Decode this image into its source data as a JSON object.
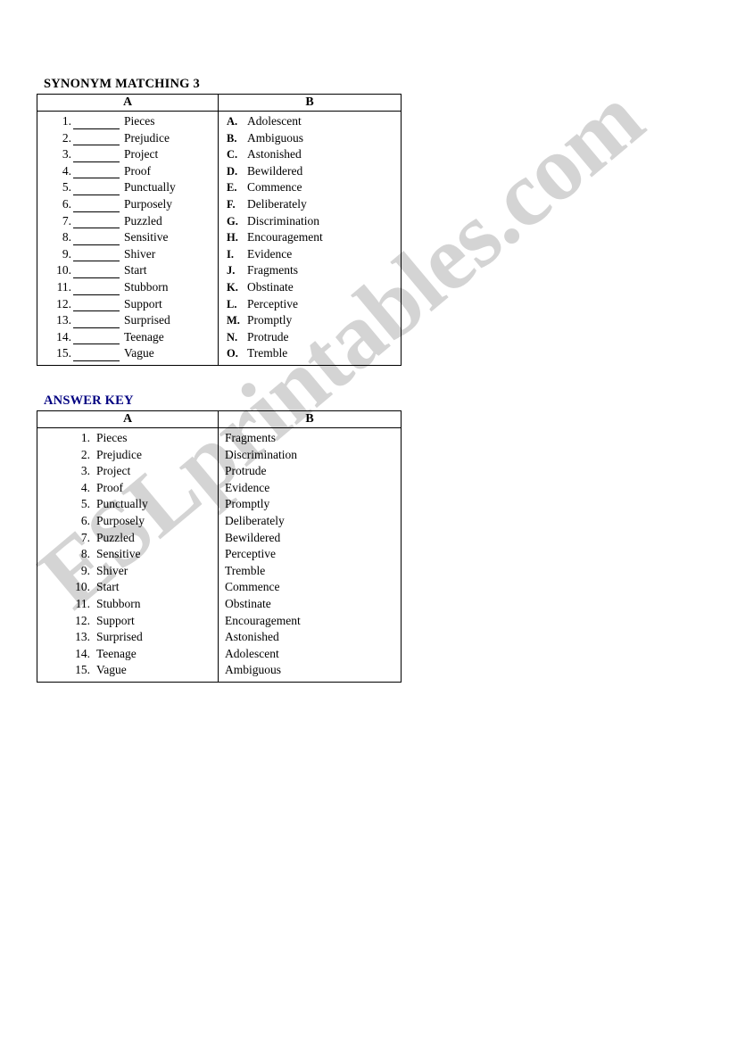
{
  "document": {
    "title": "SYNONYM MATCHING 3",
    "answer_key_title": "ANSWER KEY",
    "watermark": "ESLprintables.com",
    "colors": {
      "text": "#000000",
      "answer_key_heading": "#000080",
      "border": "#000000",
      "watermark": "#d4d4d4",
      "page_background": "#ffffff"
    }
  },
  "exercise": {
    "headers": {
      "a": "A",
      "b": "B"
    },
    "column_a": [
      {
        "num": "1.",
        "blank": "",
        "word": "Pieces"
      },
      {
        "num": "2.",
        "blank": "",
        "word": "Prejudice"
      },
      {
        "num": "3.",
        "blank": "",
        "word": "Project"
      },
      {
        "num": "4.",
        "blank": "",
        "word": "Proof"
      },
      {
        "num": "5.",
        "blank": "",
        "word": "Punctually"
      },
      {
        "num": "6.",
        "blank": "",
        "word": "Purposely"
      },
      {
        "num": "7.",
        "blank": "",
        "word": "Puzzled"
      },
      {
        "num": "8.",
        "blank": "",
        "word": "Sensitive"
      },
      {
        "num": "9.",
        "blank": "",
        "word": "Shiver"
      },
      {
        "num": "10.",
        "blank": "",
        "word": "Start"
      },
      {
        "num": "11.",
        "blank": "",
        "word": "Stubborn"
      },
      {
        "num": "12.",
        "blank": "",
        "word": "Support"
      },
      {
        "num": "13.",
        "blank": "",
        "word": "Surprised"
      },
      {
        "num": "14.",
        "blank": "",
        "word": "Teenage"
      },
      {
        "num": "15.",
        "blank": "",
        "word": "Vague"
      }
    ],
    "column_b": [
      {
        "letter": "A.",
        "word": "Adolescent"
      },
      {
        "letter": "B.",
        "word": "Ambiguous"
      },
      {
        "letter": "C.",
        "word": "Astonished"
      },
      {
        "letter": "D.",
        "word": "Bewildered"
      },
      {
        "letter": "E.",
        "word": "Commence"
      },
      {
        "letter": "F.",
        "word": "Deliberately"
      },
      {
        "letter": "G.",
        "word": "Discrimination"
      },
      {
        "letter": "H.",
        "word": "Encouragement"
      },
      {
        "letter": "I.",
        "word": "Evidence"
      },
      {
        "letter": "J.",
        "word": "Fragments"
      },
      {
        "letter": "K.",
        "word": "Obstinate"
      },
      {
        "letter": "L.",
        "word": "Perceptive"
      },
      {
        "letter": "M.",
        "word": "Promptly"
      },
      {
        "letter": "N.",
        "word": "Protrude"
      },
      {
        "letter": "O.",
        "word": "Tremble"
      }
    ]
  },
  "answer_key": {
    "headers": {
      "a": "A",
      "b": "B"
    },
    "column_a": [
      {
        "num": "1.",
        "word": "Pieces"
      },
      {
        "num": "2.",
        "word": "Prejudice"
      },
      {
        "num": "3.",
        "word": "Project"
      },
      {
        "num": "4.",
        "word": "Proof"
      },
      {
        "num": "5.",
        "word": "Punctually"
      },
      {
        "num": "6.",
        "word": "Purposely"
      },
      {
        "num": "7.",
        "word": "Puzzled"
      },
      {
        "num": "8.",
        "word": "Sensitive"
      },
      {
        "num": "9.",
        "word": "Shiver"
      },
      {
        "num": "10.",
        "word": "Start"
      },
      {
        "num": "11.",
        "word": "Stubborn"
      },
      {
        "num": "12.",
        "word": "Support"
      },
      {
        "num": "13.",
        "word": "Surprised"
      },
      {
        "num": "14.",
        "word": "Teenage"
      },
      {
        "num": "15.",
        "word": "Vague"
      }
    ],
    "column_b": [
      {
        "word": "Fragments"
      },
      {
        "word": "Discrimination"
      },
      {
        "word": "Protrude"
      },
      {
        "word": "Evidence"
      },
      {
        "word": "Promptly"
      },
      {
        "word": "Deliberately"
      },
      {
        "word": "Bewildered"
      },
      {
        "word": "Perceptive"
      },
      {
        "word": "Tremble"
      },
      {
        "word": "Commence"
      },
      {
        "word": "Obstinate"
      },
      {
        "word": "Encouragement"
      },
      {
        "word": "Astonished"
      },
      {
        "word": "Adolescent"
      },
      {
        "word": "Ambiguous"
      }
    ]
  }
}
